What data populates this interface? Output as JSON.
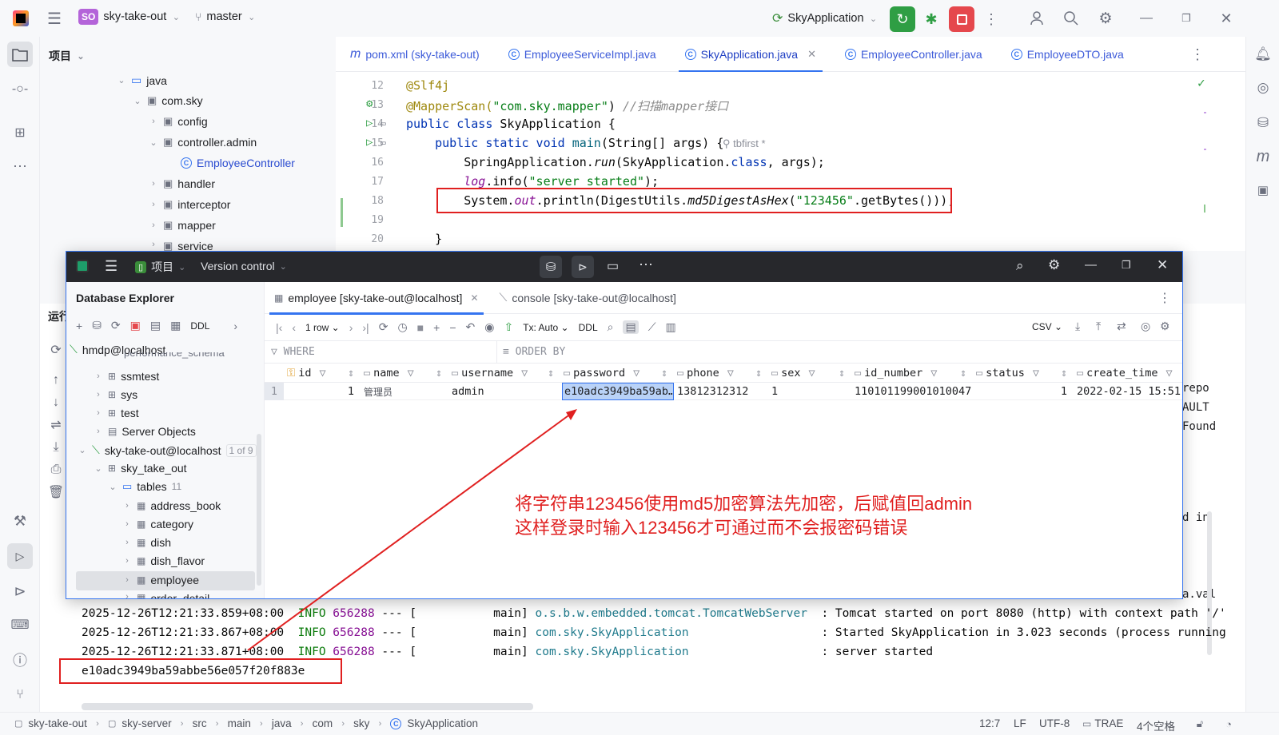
{
  "titlebar": {
    "project_badge": "SO",
    "project_name": "sky-take-out",
    "branch": "master",
    "run_config": "SkyApplication"
  },
  "project_pane": {
    "header": "项目",
    "tree": [
      {
        "label": "java",
        "kind": "folder"
      },
      {
        "label": "com.sky",
        "kind": "package"
      },
      {
        "label": "config",
        "kind": "package"
      },
      {
        "label": "controller.admin",
        "kind": "package"
      },
      {
        "label": "EmployeeController",
        "kind": "class"
      },
      {
        "label": "handler",
        "kind": "package"
      },
      {
        "label": "interceptor",
        "kind": "package"
      },
      {
        "label": "mapper",
        "kind": "package"
      },
      {
        "label": "service",
        "kind": "package"
      }
    ]
  },
  "editor": {
    "tabs": [
      {
        "label": "pom.xml (sky-take-out)",
        "icon": "m"
      },
      {
        "label": "EmployeeServiceImpl.java",
        "icon": "C"
      },
      {
        "label": "SkyApplication.java",
        "icon": "C",
        "active": true
      },
      {
        "label": "EmployeeController.java",
        "icon": "C"
      },
      {
        "label": "EmployeeDTO.java",
        "icon": "C"
      }
    ],
    "line_numbers": [
      "12",
      "13",
      "14",
      "15",
      "16",
      "17",
      "18",
      "19",
      "20"
    ],
    "code": {
      "l12": "@Slf4j",
      "l13a": "@MapperScan(",
      "l13b": "\"com.sky.mapper\"",
      "l13c": ") ",
      "l13d": "//扫描mapper接口",
      "l14a": "public class ",
      "l14b": "SkyApplication {",
      "l15a": "    public static void ",
      "l15b": "main",
      "l15c": "(String[] args) {",
      "l15_author": "tbfirst *",
      "l16a": "        SpringApplication.",
      "l16b": "run",
      "l16c": "(SkyApplication.",
      "l16d": "class",
      "l16e": ", args);",
      "l17a": "        ",
      "l17b": "log",
      "l17c": ".info(",
      "l17d": "\"server started\"",
      "l17e": ");",
      "l18a": "        System.",
      "l18b": "out",
      "l18c": ".println(DigestUtils.",
      "l18d": "md5DigestAsHex",
      "l18e": "(",
      "l18f": "\"123456\"",
      "l18g": ".getBytes()));",
      "l20": "    }"
    }
  },
  "run_panel": {
    "label": "运行",
    "right_fragments": [
      "repo",
      "AULT",
      "Found",
      "d in",
      "a.val"
    ],
    "logs": [
      {
        "ts": "2025-12-26T12:21:33.859+08:00",
        "level": "INFO",
        "pid": "656288",
        "sep": "---",
        "thread": "[           main]",
        "logger": "o.s.b.w.embedded.tomcat.TomcatWebServer",
        "msg": ": Tomcat started on port 8080 (http) with context path '/'"
      },
      {
        "ts": "2025-12-26T12:21:33.867+08:00",
        "level": "INFO",
        "pid": "656288",
        "sep": "---",
        "thread": "[           main]",
        "logger": "com.sky.SkyApplication",
        "msg": ": Started SkyApplication in 3.023 seconds (process running"
      },
      {
        "ts": "2025-12-26T12:21:33.871+08:00",
        "level": "INFO",
        "pid": "656288",
        "sep": "---",
        "thread": "[           main]",
        "logger": "com.sky.SkyApplication",
        "msg": ": server started"
      }
    ],
    "hash_output": "e10adc3949ba59abbe56e057f20f883e"
  },
  "db_window": {
    "title_project": "项目",
    "title_vcs": "Version control",
    "explorer_title": "Database Explorer",
    "tree": {
      "hmdp": "hmdp@localhost",
      "perf": "performance_schema",
      "ssmtest": "ssmtest",
      "sys": "sys",
      "test": "test",
      "server_objects": "Server Objects",
      "conn": "sky-take-out@localhost",
      "conn_count": "1 of 9",
      "schema": "sky_take_out",
      "tables": "tables",
      "tables_count": "11",
      "t1": "address_book",
      "t2": "category",
      "t3": "dish",
      "t4": "dish_flavor",
      "t5": "employee",
      "t6": "order_detail"
    },
    "tabs": [
      {
        "label": "employee [sky-take-out@localhost]",
        "active": true
      },
      {
        "label": "console [sky-take-out@localhost]"
      }
    ],
    "toolbar": {
      "rows": "1 row",
      "tx": "Tx: Auto",
      "ddl": "DDL",
      "export": "CSV",
      "left_ddl": "DDL"
    },
    "filter": {
      "where": "WHERE",
      "order": "ORDER BY"
    },
    "columns": [
      "id",
      "name",
      "username",
      "password",
      "phone",
      "sex",
      "id_number",
      "status",
      "create_time"
    ],
    "row": {
      "num": "1",
      "id": "1",
      "name": "管理员",
      "username": "admin",
      "password": "e10adc3949ba59ab…",
      "phone": "13812312312",
      "sex": "1",
      "id_number": "110101199001010047",
      "status": "1",
      "create_time": "2022-02-15 15:51:"
    }
  },
  "annotation": {
    "line1": "将字符串123456使用md5加密算法先加密，后赋值回admin",
    "line2": "这样登录时输入123456才可通过而不会报密码错误",
    "color": "#e02020"
  },
  "statusbar": {
    "crumbs": [
      "sky-take-out",
      "sky-server",
      "src",
      "main",
      "java",
      "com",
      "sky",
      "SkyApplication"
    ],
    "position": "12:7",
    "line_sep": "LF",
    "encoding": "UTF-8",
    "plugin": "TRAE",
    "indent": "4个空格"
  }
}
